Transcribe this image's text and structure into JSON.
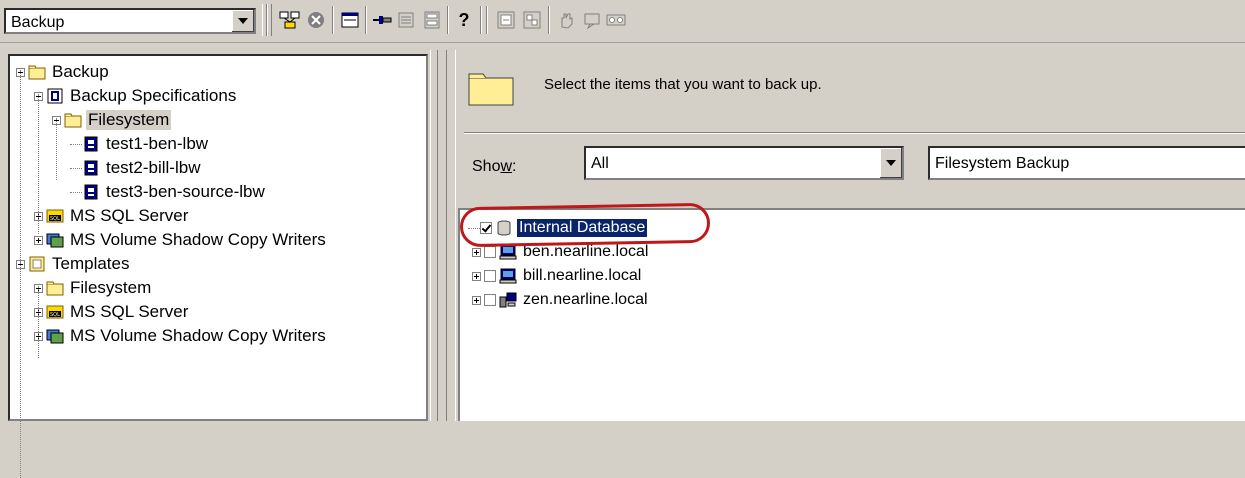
{
  "toolbar": {
    "context_combo": "Backup",
    "icons": [
      "network-icon",
      "stop-icon",
      "properties-icon",
      "pin-icon",
      "list-icon",
      "cabinet-icon",
      "help-icon",
      "wizard1-icon",
      "wizard2-icon",
      "hand-icon",
      "flash-icon",
      "tape-icon"
    ]
  },
  "left_tree": [
    {
      "label": "Backup",
      "icon": "folder-icon",
      "expander": "minus"
    },
    {
      "label": "Backup Specifications",
      "icon": "backup-spec-icon",
      "expander": "minus"
    },
    {
      "label": "Filesystem",
      "icon": "folder-icon",
      "expander": "minus",
      "selected": true
    },
    {
      "label": "test1-ben-lbw",
      "icon": "spec-item-icon"
    },
    {
      "label": "test2-bill-lbw",
      "icon": "spec-item-icon"
    },
    {
      "label": "test3-ben-source-lbw",
      "icon": "spec-item-icon"
    },
    {
      "label": "MS SQL Server",
      "icon": "sql-icon",
      "expander": "plus"
    },
    {
      "label": "MS Volume Shadow Copy Writers",
      "icon": "shadow-copy-icon",
      "expander": "plus"
    },
    {
      "label": "Templates",
      "icon": "templates-icon",
      "expander": "minus"
    },
    {
      "label": "Filesystem",
      "icon": "folder-icon",
      "expander": "plus"
    },
    {
      "label": "MS SQL Server",
      "icon": "sql-icon",
      "expander": "plus"
    },
    {
      "label": "MS Volume Shadow Copy Writers",
      "icon": "shadow-copy-icon",
      "expander": "plus"
    }
  ],
  "right": {
    "instruction": "Select the items that you want to back up.",
    "show_label_pre": "Sho",
    "show_label_u": "w",
    "show_label_post": ":",
    "show_value": "All",
    "type_value": "Filesystem Backup",
    "items": [
      {
        "label": "Internal Database",
        "checked": true,
        "selected": true,
        "icon": "database-icon"
      },
      {
        "label": "ben.nearline.local",
        "checked": false,
        "icon": "computer-icon"
      },
      {
        "label": "bill.nearline.local",
        "checked": false,
        "icon": "computer-icon"
      },
      {
        "label": "zen.nearline.local",
        "checked": false,
        "icon": "cluster-icon"
      }
    ]
  },
  "colors": {
    "highlight_circle": "#c0181a",
    "selection": "#0a246a"
  }
}
